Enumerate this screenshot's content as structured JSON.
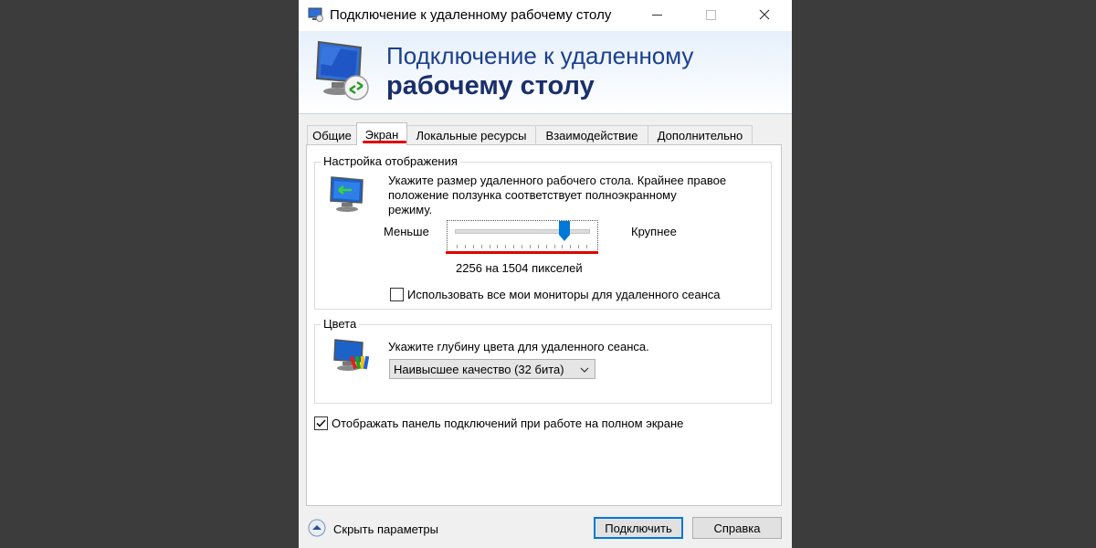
{
  "window": {
    "title": "Подключение к удаленному рабочему столу"
  },
  "banner": {
    "line1": "Подключение к удаленному",
    "line2": "рабочему столу"
  },
  "tabs": [
    {
      "label": "Общие",
      "active": false
    },
    {
      "label": "Экран",
      "active": true
    },
    {
      "label": "Локальные ресурсы",
      "active": false
    },
    {
      "label": "Взаимодействие",
      "active": false
    },
    {
      "label": "Дополнительно",
      "active": false
    }
  ],
  "display_settings": {
    "group_label": "Настройка отображения",
    "description_line1": "Укажите размер удаленного рабочего стола. Крайнее правое",
    "description_line2": "положение ползунка соответствует полноэкранному",
    "description_line3": "режиму.",
    "slider_min_label": "Меньше",
    "slider_max_label": "Крупнее",
    "slider_position_fraction": 0.83,
    "resolution_text": "2256 на 1504 пикселей",
    "multimonitor_label": "Использовать все мои мониторы для удаленного сеанса",
    "multimonitor_checked": false
  },
  "colors": {
    "group_label": "Цвета",
    "description": "Укажите глубину цвета для удаленного сеанса.",
    "depth_selected": "Наивысшее качество (32 бита)"
  },
  "connection_bar": {
    "label": "Отображать панель подключений при работе на полном экране",
    "checked": true
  },
  "footer": {
    "hide_options_label": "Скрыть параметры",
    "connect_label": "Подключить",
    "help_label": "Справка"
  },
  "theme": {
    "accent": "#0078d7",
    "banner_title": "#1b3f8c",
    "highlight_red": "#e00000"
  }
}
